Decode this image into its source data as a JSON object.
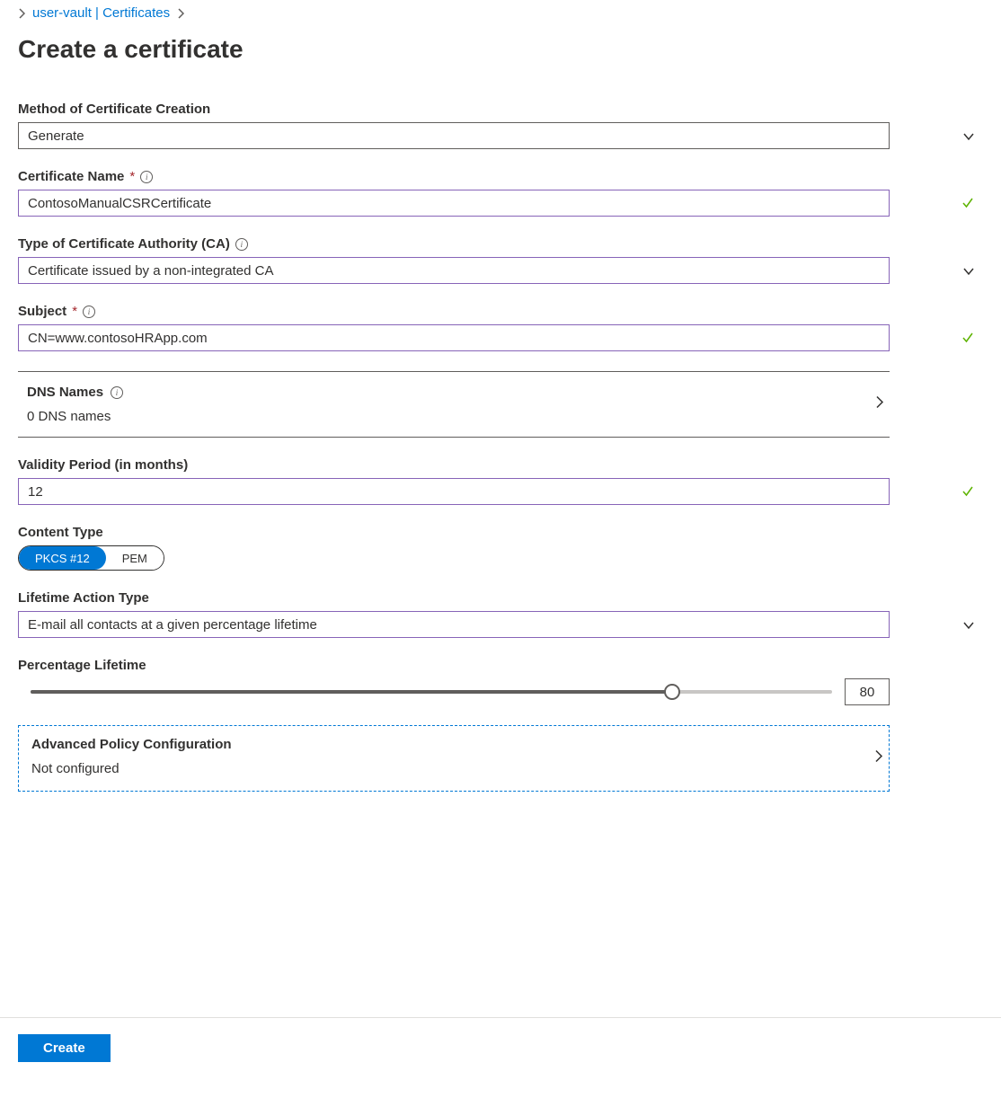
{
  "breadcrumb": {
    "link_text": "user-vault | Certificates"
  },
  "page_title": "Create a certificate",
  "fields": {
    "method": {
      "label": "Method of Certificate Creation",
      "value": "Generate"
    },
    "name": {
      "label": "Certificate Name",
      "value": "ContosoManualCSRCertificate"
    },
    "ca_type": {
      "label": "Type of Certificate Authority (CA)",
      "value": "Certificate issued by a non-integrated CA"
    },
    "subject": {
      "label": "Subject",
      "value": "CN=www.contosoHRApp.com"
    },
    "dns": {
      "label": "DNS Names",
      "value": "0 DNS names"
    },
    "validity": {
      "label": "Validity Period (in months)",
      "value": "12"
    },
    "content_type": {
      "label": "Content Type",
      "option_a": "PKCS #12",
      "option_b": "PEM"
    },
    "lifetime_action": {
      "label": "Lifetime Action Type",
      "value": "E-mail all contacts at a given percentage lifetime"
    },
    "percentage": {
      "label": "Percentage Lifetime",
      "value": "80"
    },
    "advanced": {
      "label": "Advanced Policy Configuration",
      "value": "Not configured"
    }
  },
  "footer": {
    "create_label": "Create"
  },
  "slider": {
    "percent": 80
  }
}
